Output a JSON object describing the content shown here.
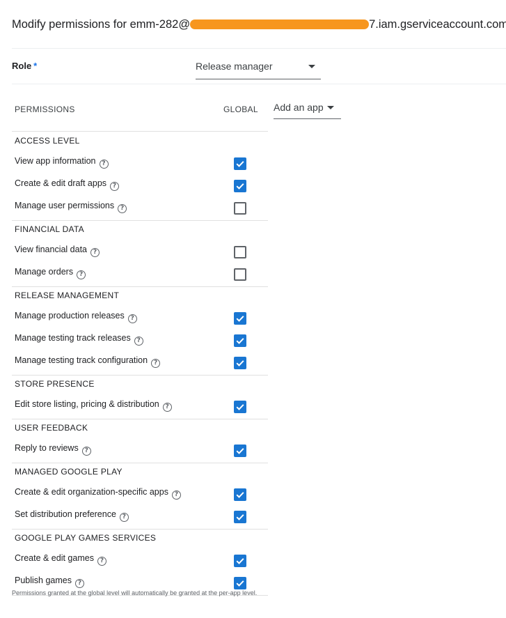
{
  "dialog": {
    "title_prefix": "Modify permissions for emm-282@",
    "title_suffix": "7.iam.gserviceaccount.com"
  },
  "role": {
    "label": "Role",
    "required_marker": "*",
    "selected": "Release manager"
  },
  "table": {
    "header_permissions": "PERMISSIONS",
    "header_global": "GLOBAL",
    "add_app_label": "Add an app"
  },
  "sections": [
    {
      "name": "ACCESS LEVEL",
      "items": [
        {
          "label": "View app information",
          "checked": true
        },
        {
          "label": "Create & edit draft apps",
          "checked": true
        },
        {
          "label": "Manage user permissions",
          "checked": false
        }
      ]
    },
    {
      "name": "FINANCIAL DATA",
      "items": [
        {
          "label": "View financial data",
          "checked": false
        },
        {
          "label": "Manage orders",
          "checked": false
        }
      ]
    },
    {
      "name": "RELEASE MANAGEMENT",
      "items": [
        {
          "label": "Manage production releases",
          "checked": true
        },
        {
          "label": "Manage testing track releases",
          "checked": true
        },
        {
          "label": "Manage testing track configuration",
          "checked": true
        }
      ]
    },
    {
      "name": "STORE PRESENCE",
      "items": [
        {
          "label": "Edit store listing, pricing & distribution",
          "checked": true
        }
      ]
    },
    {
      "name": "USER FEEDBACK",
      "items": [
        {
          "label": "Reply to reviews",
          "checked": true
        }
      ]
    },
    {
      "name": "MANAGED GOOGLE PLAY",
      "items": [
        {
          "label": "Create & edit organization-specific apps",
          "checked": true
        },
        {
          "label": "Set distribution preference",
          "checked": true
        }
      ]
    },
    {
      "name": "GOOGLE PLAY GAMES SERVICES",
      "items": [
        {
          "label": "Create & edit games",
          "checked": true
        },
        {
          "label": "Publish games",
          "checked": true
        }
      ]
    }
  ],
  "footnote": "Permissions granted at the global level will automatically be granted at the per-app level.",
  "icons": {
    "help": "help-circle-icon",
    "dropdown": "triangle-down-icon",
    "checkbox_checked": "check-icon"
  },
  "colors": {
    "checkbox_on": "#1976d2",
    "redaction": "#f7961e",
    "required": "#1a73e8"
  }
}
